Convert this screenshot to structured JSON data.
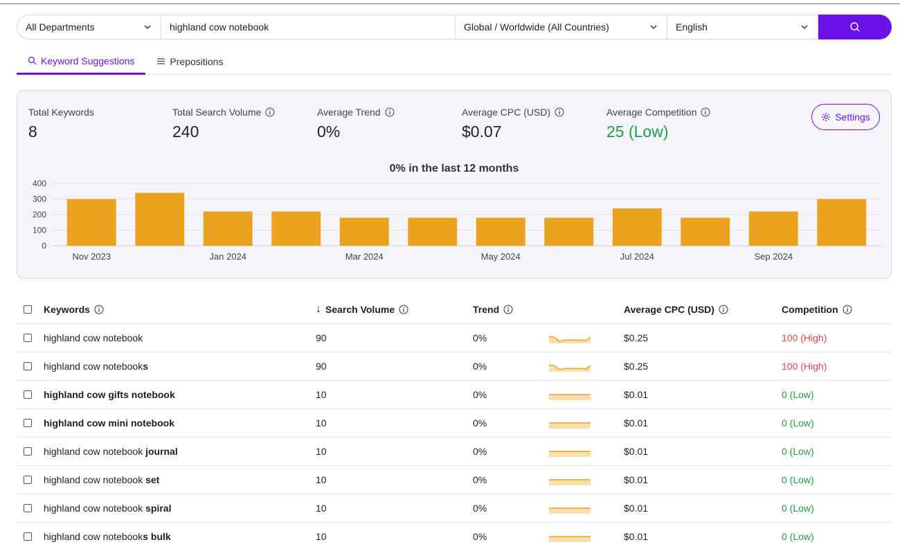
{
  "search": {
    "department": "All Departments",
    "query": "highland cow notebook",
    "country": "Global / Worldwide (All Countries)",
    "language": "English",
    "icons": {
      "dropdown": "chevron-down-icon",
      "submit": "search-icon"
    },
    "accent": "#6c11e8"
  },
  "tabs": [
    {
      "label": "Keyword Suggestions",
      "icon": "search-icon",
      "active": true
    },
    {
      "label": "Prepositions",
      "icon": "list-icon",
      "active": false
    }
  ],
  "summary": {
    "total_keywords_label": "Total Keywords",
    "total_keywords": "8",
    "total_volume_label": "Total Search Volume",
    "total_volume": "240",
    "avg_trend_label": "Average Trend",
    "avg_trend": "0%",
    "avg_cpc_label": "Average CPC (USD)",
    "avg_cpc": "$0.07",
    "avg_comp_label": "Average Competition",
    "avg_comp": "25 (Low)",
    "settings_label": "Settings"
  },
  "chart_data": {
    "type": "bar",
    "title": "0% in the last 12 months",
    "categories": [
      "Nov 2023",
      "Dec 2023",
      "Jan 2024",
      "Feb 2024",
      "Mar 2024",
      "Apr 2024",
      "May 2024",
      "Jun 2024",
      "Jul 2024",
      "Aug 2024",
      "Sep 2024",
      "Oct 2024"
    ],
    "tick_labels": [
      "Nov 2023",
      "",
      "Jan 2024",
      "",
      "Mar 2024",
      "",
      "May 2024",
      "",
      "Jul 2024",
      "",
      "Sep 2024",
      ""
    ],
    "values": [
      300,
      340,
      220,
      220,
      180,
      180,
      180,
      180,
      240,
      180,
      220,
      300
    ],
    "yticks": [
      0,
      100,
      200,
      300,
      400
    ],
    "ylim": [
      0,
      400
    ],
    "grid": true,
    "bar_color": "#eba21e"
  },
  "table": {
    "headers": {
      "keywords": "Keywords",
      "sort_arrow": "↓",
      "volume": "Search Volume",
      "trend": "Trend",
      "cpc": "Average CPC (USD)",
      "competition": "Competition"
    },
    "rows": [
      {
        "base": "highland cow notebook",
        "suffix": "",
        "volume": "90",
        "trend": "0%",
        "cpc": "$0.25",
        "competition": "100 (High)",
        "level": "high",
        "spark": [
          0.6,
          0.55,
          0.2,
          0.3,
          0.3,
          0.3,
          0.3,
          0.25,
          0.55
        ]
      },
      {
        "base": "highland cow notebook",
        "suffix": "s",
        "volume": "90",
        "trend": "0%",
        "cpc": "$0.25",
        "competition": "100 (High)",
        "level": "high",
        "spark": [
          0.6,
          0.55,
          0.2,
          0.3,
          0.3,
          0.3,
          0.3,
          0.25,
          0.55
        ]
      },
      {
        "base": "",
        "suffix": "highland cow gifts notebook",
        "volume": "10",
        "trend": "0%",
        "cpc": "$0.01",
        "competition": "0 (Low)",
        "level": "low",
        "spark": [
          0.5,
          0.5,
          0.5,
          0.5,
          0.5,
          0.5,
          0.5,
          0.5,
          0.5
        ]
      },
      {
        "base": "",
        "suffix": "highland cow mini notebook",
        "volume": "10",
        "trend": "0%",
        "cpc": "$0.01",
        "competition": "0 (Low)",
        "level": "low",
        "spark": [
          0.5,
          0.5,
          0.5,
          0.5,
          0.5,
          0.5,
          0.5,
          0.5,
          0.5
        ]
      },
      {
        "base": "highland cow notebook ",
        "suffix": "journal",
        "volume": "10",
        "trend": "0%",
        "cpc": "$0.01",
        "competition": "0 (Low)",
        "level": "low",
        "spark": [
          0.5,
          0.5,
          0.5,
          0.5,
          0.5,
          0.5,
          0.5,
          0.5,
          0.5
        ]
      },
      {
        "base": "highland cow notebook ",
        "suffix": "set",
        "volume": "10",
        "trend": "0%",
        "cpc": "$0.01",
        "competition": "0 (Low)",
        "level": "low",
        "spark": [
          0.5,
          0.5,
          0.5,
          0.5,
          0.5,
          0.5,
          0.5,
          0.5,
          0.5
        ]
      },
      {
        "base": "highland cow notebook ",
        "suffix": "spiral",
        "volume": "10",
        "trend": "0%",
        "cpc": "$0.01",
        "competition": "0 (Low)",
        "level": "low",
        "spark": [
          0.5,
          0.5,
          0.5,
          0.5,
          0.5,
          0.5,
          0.5,
          0.5,
          0.5
        ]
      },
      {
        "base": "highland cow notebook",
        "suffix": "s bulk",
        "volume": "10",
        "trend": "0%",
        "cpc": "$0.01",
        "competition": "0 (Low)",
        "level": "low",
        "spark": [
          0.5,
          0.5,
          0.5,
          0.5,
          0.5,
          0.5,
          0.5,
          0.5,
          0.5
        ]
      }
    ],
    "colors": {
      "high": "#e0464f",
      "low": "#1e9e46",
      "spark_line": "#eba21e",
      "spark_fill": "#f7dfb1"
    }
  }
}
